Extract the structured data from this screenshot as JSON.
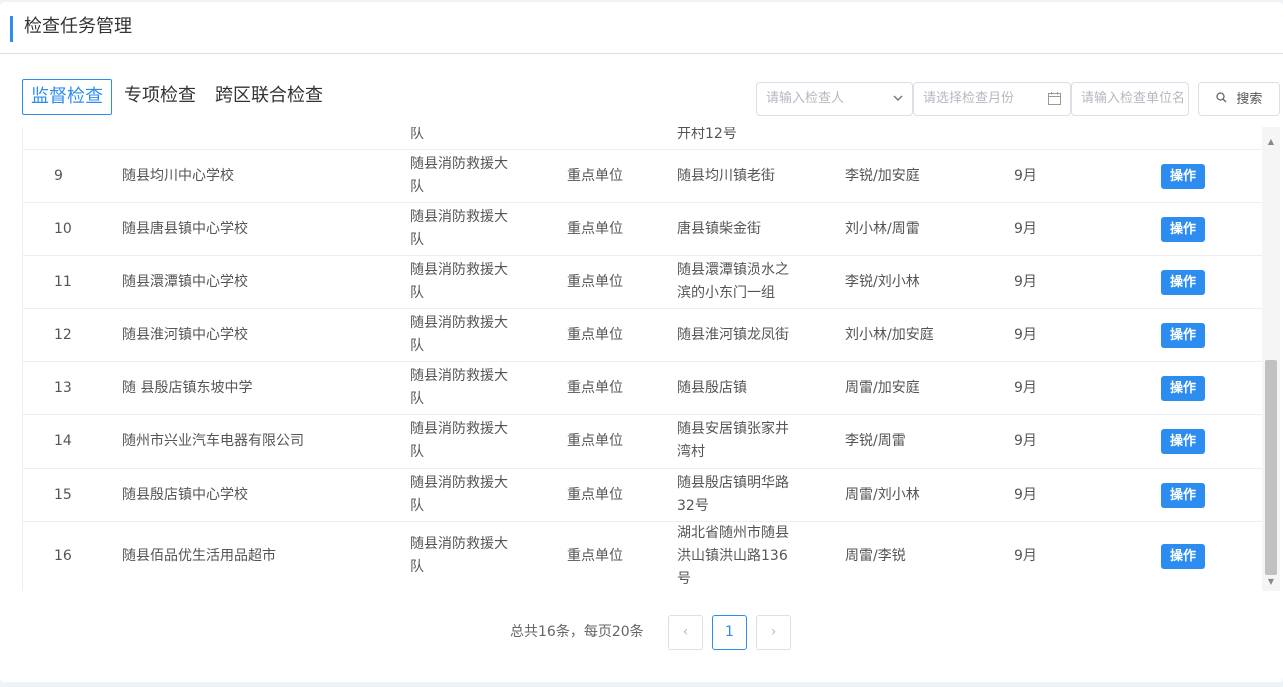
{
  "header": {
    "title": "检查任务管理"
  },
  "tabs": [
    {
      "label": "监督检查",
      "active": true
    },
    {
      "label": "专项检查",
      "active": false
    },
    {
      "label": "跨区联合检查",
      "active": false
    }
  ],
  "filters": {
    "inspector_placeholder": "请输入检查人",
    "month_placeholder": "请选择检查月份",
    "unit_placeholder": "请输入检查单位名",
    "search_label": "搜索"
  },
  "colors": {
    "accent": "#2d8cf0"
  },
  "table": {
    "partial_top_row": {
      "team": "队",
      "address": "开村12号"
    },
    "rows": [
      {
        "index": "9",
        "unit": "随县均川中心学校",
        "team_line1": "随县消防救援大",
        "team_line2": "队",
        "type": "重点单位",
        "address_lines": [
          "随县均川镇老街"
        ],
        "inspectors": "李锐/加安庭",
        "month": "9月",
        "op": "操作"
      },
      {
        "index": "10",
        "unit": "随县唐县镇中心学校",
        "team_line1": "随县消防救援大",
        "team_line2": "队",
        "type": "重点单位",
        "address_lines": [
          "唐县镇柴金街"
        ],
        "inspectors": "刘小林/周雷",
        "month": "9月",
        "op": "操作"
      },
      {
        "index": "11",
        "unit": "随县澴潭镇中心学校",
        "team_line1": "随县消防救援大",
        "team_line2": "队",
        "type": "重点单位",
        "address_lines": [
          "随县澴潭镇涢水之",
          "滨的小东门一组"
        ],
        "inspectors": "李锐/刘小林",
        "month": "9月",
        "op": "操作"
      },
      {
        "index": "12",
        "unit": "随县淮河镇中心学校",
        "team_line1": "随县消防救援大",
        "team_line2": "队",
        "type": "重点单位",
        "address_lines": [
          "随县淮河镇龙凤街"
        ],
        "inspectors": "刘小林/加安庭",
        "month": "9月",
        "op": "操作"
      },
      {
        "index": "13",
        "unit": "随 县殷店镇东坡中学",
        "team_line1": "随县消防救援大",
        "team_line2": "队",
        "type": "重点单位",
        "address_lines": [
          "随县殷店镇"
        ],
        "inspectors": "周雷/加安庭",
        "month": "9月",
        "op": "操作"
      },
      {
        "index": "14",
        "unit": "随州市兴业汽车电器有限公司",
        "team_line1": "随县消防救援大",
        "team_line2": "队",
        "type": "重点单位",
        "address_lines": [
          "随县安居镇张家井",
          "湾村"
        ],
        "inspectors": "李锐/周雷",
        "month": "9月",
        "op": "操作"
      },
      {
        "index": "15",
        "unit": "随县殷店镇中心学校",
        "team_line1": "随县消防救援大",
        "team_line2": "队",
        "type": "重点单位",
        "address_lines": [
          "随县殷店镇明华路",
          "32号"
        ],
        "inspectors": "周雷/刘小林",
        "month": "9月",
        "op": "操作"
      },
      {
        "index": "16",
        "unit": "随县佰品优生活用品超市",
        "team_line1": "随县消防救援大",
        "team_line2": "队",
        "type": "重点单位",
        "address_lines": [
          "湖北省随州市随县",
          "洪山镇洪山路136",
          "号"
        ],
        "inspectors": "周雷/李锐",
        "month": "9月",
        "op": "操作"
      }
    ]
  },
  "pagination": {
    "total_text": "总共16条，每页20条",
    "prev": "‹",
    "current": "1",
    "next": "›"
  }
}
